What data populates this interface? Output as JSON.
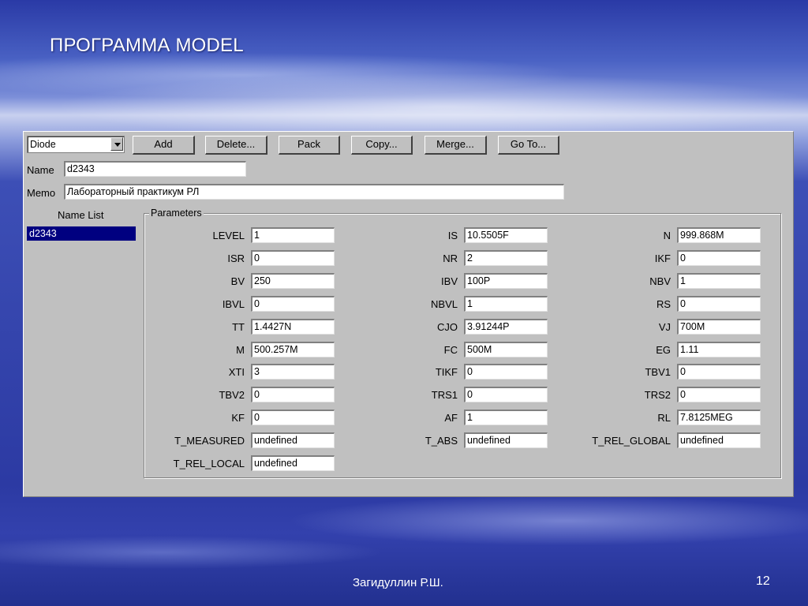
{
  "slide": {
    "title": "ПРОГРАММА MODEL",
    "author": "Загидуллин Р.Ш.",
    "page_number": "12"
  },
  "toolbar": {
    "device_type": "Diode",
    "buttons": [
      "Add",
      "Delete...",
      "Pack",
      "Copy...",
      "Merge...",
      "Go To..."
    ]
  },
  "form": {
    "name_label": "Name",
    "name_value": "d2343",
    "memo_label": "Memo",
    "memo_value": "Лабораторный практикум РЛ"
  },
  "name_list": {
    "label": "Name List",
    "items": [
      "d2343"
    ]
  },
  "parameters": {
    "title": "Parameters",
    "columns": [
      [
        {
          "name": "LEVEL",
          "value": "1"
        },
        {
          "name": "ISR",
          "value": "0"
        },
        {
          "name": "BV",
          "value": "250"
        },
        {
          "name": "IBVL",
          "value": "0"
        },
        {
          "name": "TT",
          "value": "1.4427N"
        },
        {
          "name": "M",
          "value": "500.257M"
        },
        {
          "name": "XTI",
          "value": "3"
        },
        {
          "name": "TBV2",
          "value": "0"
        },
        {
          "name": "KF",
          "value": "0"
        },
        {
          "name": "T_MEASURED",
          "value": "undefined"
        },
        {
          "name": "T_REL_LOCAL",
          "value": "undefined"
        }
      ],
      [
        {
          "name": "IS",
          "value": "10.5505F"
        },
        {
          "name": "NR",
          "value": "2"
        },
        {
          "name": "IBV",
          "value": "100P"
        },
        {
          "name": "NBVL",
          "value": "1"
        },
        {
          "name": "CJO",
          "value": "3.91244P"
        },
        {
          "name": "FC",
          "value": "500M"
        },
        {
          "name": "TIKF",
          "value": "0"
        },
        {
          "name": "TRS1",
          "value": "0"
        },
        {
          "name": "AF",
          "value": "1"
        },
        {
          "name": "T_ABS",
          "value": "undefined"
        }
      ],
      [
        {
          "name": "N",
          "value": "999.868M"
        },
        {
          "name": "IKF",
          "value": "0"
        },
        {
          "name": "NBV",
          "value": "1"
        },
        {
          "name": "RS",
          "value": "0"
        },
        {
          "name": "VJ",
          "value": "700M"
        },
        {
          "name": "EG",
          "value": "1.11"
        },
        {
          "name": "TBV1",
          "value": "0"
        },
        {
          "name": "TRS2",
          "value": "0"
        },
        {
          "name": "RL",
          "value": "7.8125MEG"
        },
        {
          "name": "T_REL_GLOBAL",
          "value": "undefined"
        }
      ]
    ]
  }
}
